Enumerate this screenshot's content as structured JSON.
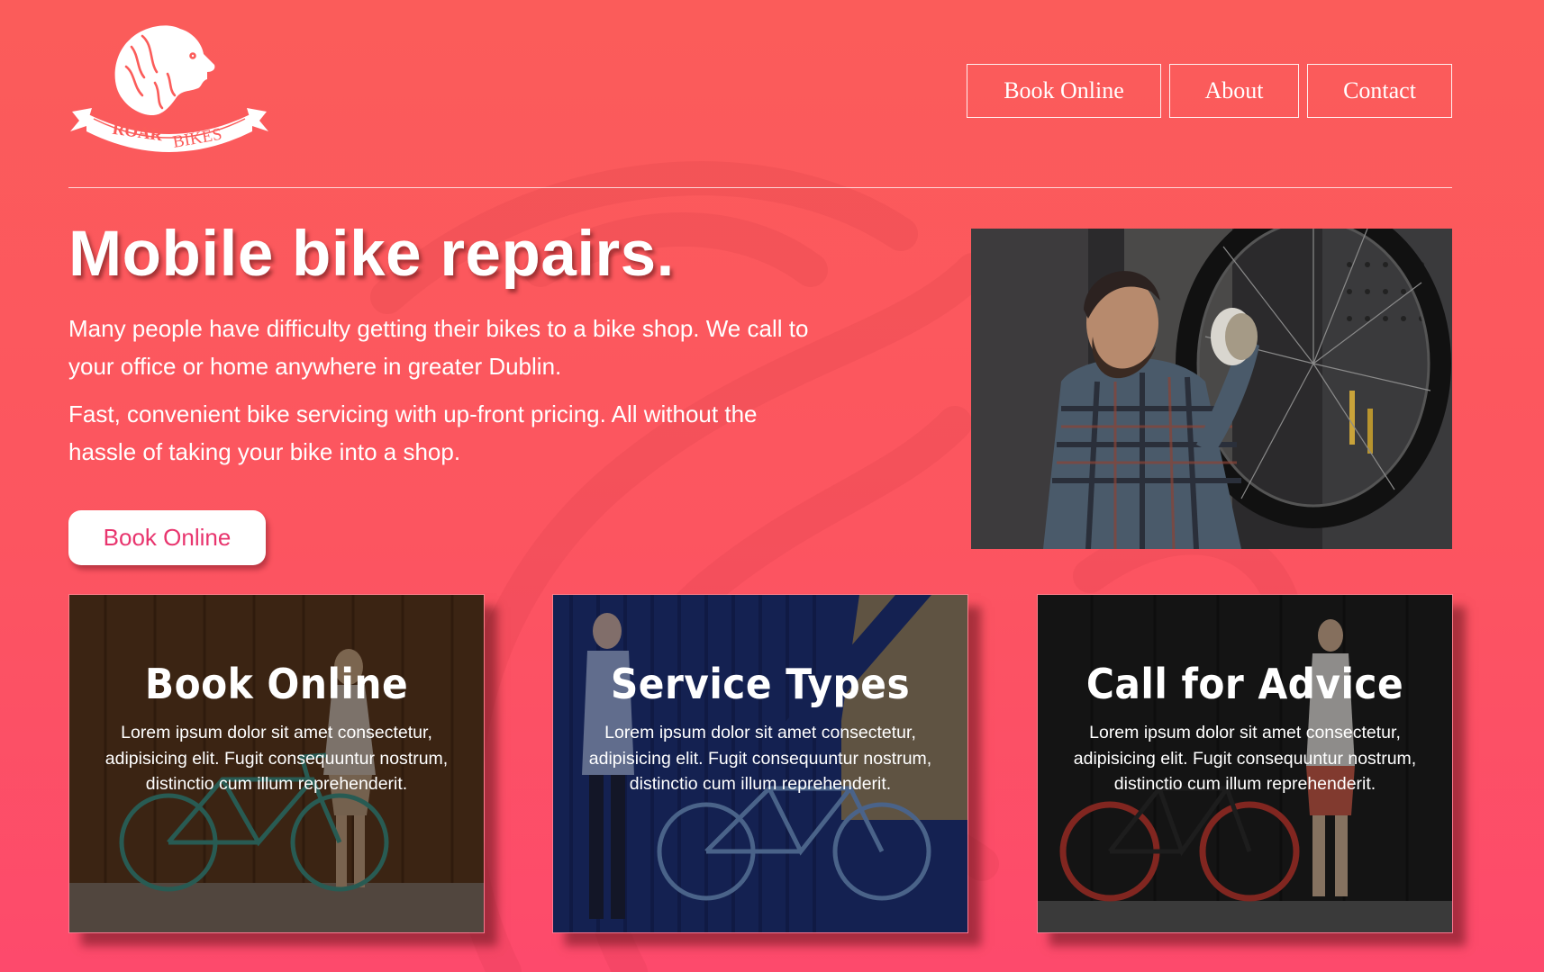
{
  "brand": {
    "logo_text_bold": "ROAR",
    "logo_text_light": "BIKES"
  },
  "nav": [
    {
      "label": "Book Online"
    },
    {
      "label": "About"
    },
    {
      "label": "Contact"
    }
  ],
  "hero": {
    "title": "Mobile bike repairs.",
    "paragraphs": [
      "Many people have difficulty getting their bikes to a bike shop. We call to your office or home anywhere in greater Dublin.",
      "Fast, convenient bike servicing with up-front pricing. All without the hassle of taking your bike into a shop."
    ],
    "cta_label": "Book Online"
  },
  "cards": [
    {
      "title": "Book Online",
      "text": "Lorem ipsum dolor sit amet consectetur, adipisicing elit. Fugit consequuntur nostrum, distinctio cum illum reprehenderit."
    },
    {
      "title": "Service Types",
      "text": "Lorem ipsum dolor sit amet consectetur, adipisicing elit. Fugit consequuntur nostrum, distinctio cum illum reprehenderit."
    },
    {
      "title": "Call for Advice",
      "text": "Lorem ipsum dolor sit amet consectetur, adipisicing elit. Fugit consequuntur nostrum, distinctio cum illum reprehenderit."
    }
  ],
  "colors": {
    "background_top": "#fb5c5a",
    "background_bottom": "#fd4a6c",
    "cta_text": "#e8356e"
  }
}
